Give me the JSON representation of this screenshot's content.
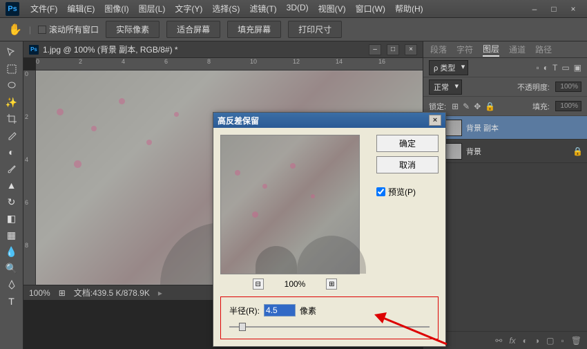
{
  "app": {
    "name": "Ps"
  },
  "menu": {
    "items": [
      "文件(F)",
      "编辑(E)",
      "图像(I)",
      "图层(L)",
      "文字(Y)",
      "选择(S)",
      "滤镜(T)",
      "3D(D)",
      "视图(V)",
      "窗口(W)",
      "帮助(H)"
    ]
  },
  "options": {
    "scroll_all": "滚动所有窗口",
    "actual_pixels": "实际像素",
    "fit_screen": "适合屏幕",
    "fill_screen": "填充屏幕",
    "print_size": "打印尺寸"
  },
  "document": {
    "title": "1.jpg @ 100% (背景 副本, RGB/8#) *",
    "zoom": "100%",
    "doc_size": "文档:439.5 K/878.9K",
    "ruler_h": [
      "0",
      "2",
      "4",
      "6",
      "8",
      "10",
      "12",
      "14",
      "16"
    ],
    "ruler_v": [
      "0",
      "2",
      "4",
      "6",
      "8"
    ]
  },
  "panels": {
    "tabs_top": [
      "段落",
      "字符",
      "图层",
      "通道",
      "路径"
    ],
    "active_tab": "图层",
    "kind_label": "ρ 类型",
    "blend_mode": "正常",
    "opacity_label": "不透明度:",
    "opacity_value": "100%",
    "lock_label": "锁定:",
    "fill_label": "填充:",
    "fill_value": "100%",
    "layers": [
      {
        "name": "背景 副本",
        "locked": false,
        "selected": true
      },
      {
        "name": "背景",
        "locked": true,
        "selected": false
      }
    ]
  },
  "dialog": {
    "title": "高反差保留",
    "ok": "确定",
    "cancel": "取消",
    "preview": "预览(P)",
    "preview_checked": true,
    "zoom": "100%",
    "radius_label": "半径(R):",
    "radius_value": "4.5",
    "radius_unit": "像素"
  }
}
